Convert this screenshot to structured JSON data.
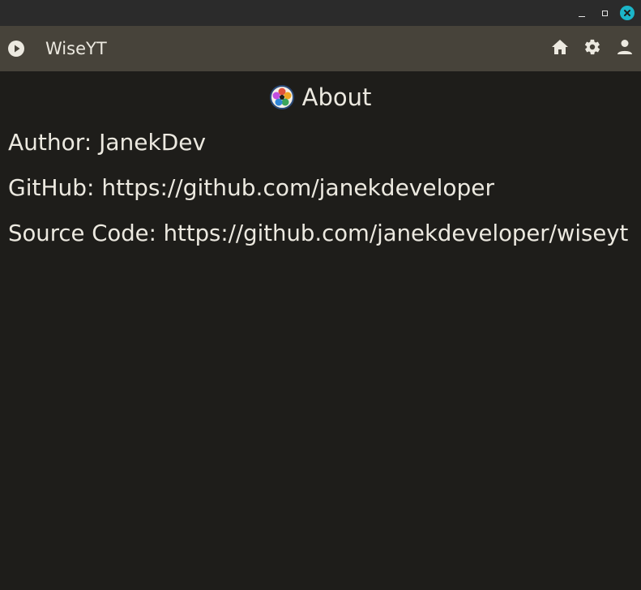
{
  "window": {
    "controls": {
      "minimize_icon": "minimize-icon",
      "maximize_icon": "maximize-icon",
      "close_icon": "close-icon",
      "close_color": "#1bb5c8"
    }
  },
  "appbar": {
    "title": "WiseYT",
    "logo_icon": "play-circle-icon",
    "actions": [
      {
        "icon": "home-icon"
      },
      {
        "icon": "gear-icon"
      },
      {
        "icon": "person-icon"
      }
    ],
    "background": "#47433a"
  },
  "about": {
    "title": "About",
    "logo_icon": "wiseyt-logo-icon",
    "author": {
      "label": "Author: ",
      "value": "JanekDev"
    },
    "github": {
      "label": "GitHub: ",
      "value": "https://github.com/janekdeveloper"
    },
    "source": {
      "label": "Source Code: ",
      "value": "https://github.com/janekdeveloper/wiseyt"
    }
  },
  "colors": {
    "background": "#1e1d1a",
    "text": "#ece9e0",
    "titlebar": "#2b2b2b"
  }
}
